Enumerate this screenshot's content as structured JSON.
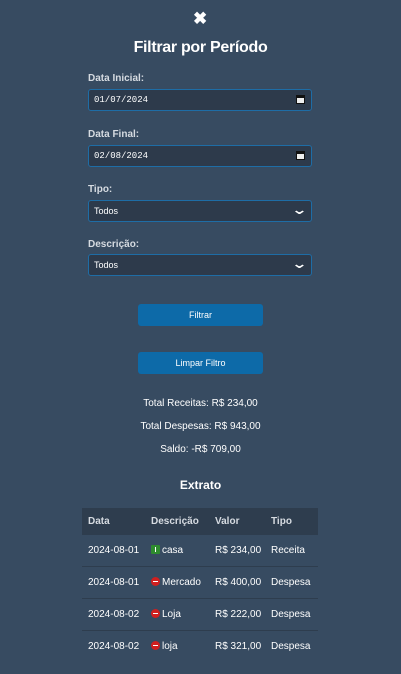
{
  "header": {
    "close_glyph": "✖",
    "title": "Filtrar por Período"
  },
  "form": {
    "start_label": "Data Inicial:",
    "start_value": "01/07/2024",
    "end_label": "Data Final:",
    "end_value": "02/08/2024",
    "type_label": "Tipo:",
    "type_value": "Todos",
    "desc_label": "Descrição:",
    "desc_value": "Todos",
    "filter_button": "Filtrar",
    "clear_button": "Limpar Filtro"
  },
  "totals": {
    "income": "Total Receitas: R$ 234,00",
    "expense": "Total Despesas: R$ 943,00",
    "balance": "Saldo: -R$ 709,00"
  },
  "statement": {
    "title": "Extrato",
    "columns": [
      "Data",
      "Descrição",
      "Valor",
      "Tipo"
    ],
    "rows": [
      {
        "date": "2024-08-01",
        "icon": "income-icon",
        "desc": "casa",
        "value": "R$ 234,00",
        "type": "Receita"
      },
      {
        "date": "2024-08-01",
        "icon": "expense-icon",
        "desc": "Mercado",
        "value": "R$ 400,00",
        "type": "Despesa"
      },
      {
        "date": "2024-08-02",
        "icon": "expense-icon",
        "desc": "Loja",
        "value": "R$ 222,00",
        "type": "Despesa"
      },
      {
        "date": "2024-08-02",
        "icon": "expense-icon",
        "desc": "loja",
        "value": "R$ 321,00",
        "type": "Despesa"
      }
    ]
  },
  "colors": {
    "background": "#374b61",
    "accent": "#0d6aa8",
    "income": "#2e8b2e",
    "expense": "#d01f1f"
  }
}
